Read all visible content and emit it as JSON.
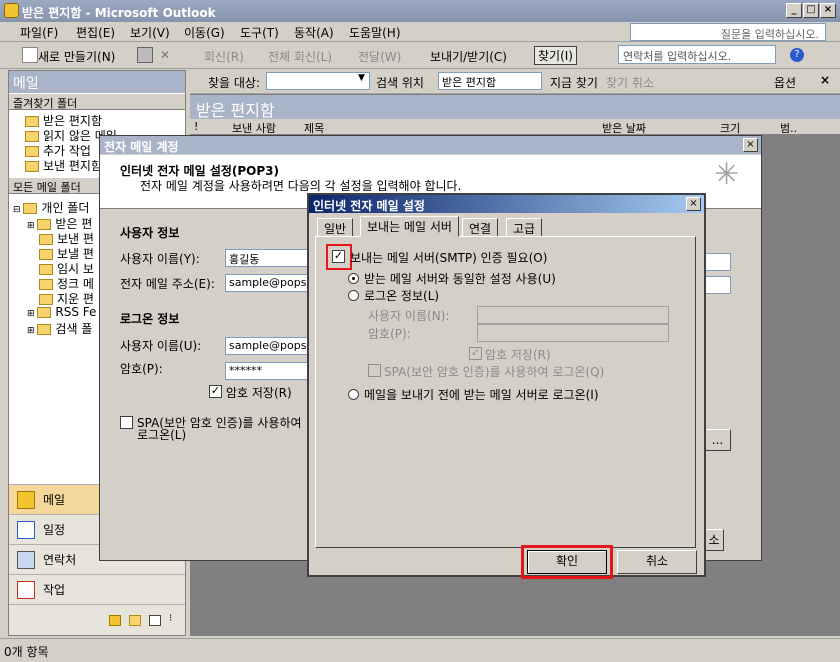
{
  "window": {
    "title": "받은 편지함 - Microsoft Outlook",
    "controls": [
      "_",
      "□",
      "×"
    ]
  },
  "menu": {
    "items": [
      "파일(F)",
      "편집(E)",
      "보기(V)",
      "이동(G)",
      "도구(T)",
      "동작(A)",
      "도움말(H)"
    ],
    "help_placeholder": "질문을 입력하십시오."
  },
  "toolbar": {
    "new": "새로 만들기(N)",
    "reply": "회신(R)",
    "reply_all": "전체 회신(L)",
    "forward": "전달(W)",
    "send_receive": "보내기/받기(C)",
    "find": "찾기(I)",
    "contacts_placeholder": "연락처를 입력하십시오."
  },
  "nav": {
    "header": "메일",
    "favorites_label": "즐겨찾기 폴더",
    "favorites": [
      "받은 편지함",
      "읽지 않은 메일",
      "추가 작업",
      "보낸 편지함"
    ],
    "all_label": "모든 메일 폴더",
    "personal": "개인 폴더",
    "tree": [
      "받은 편",
      "보낸 편",
      "보낼 편",
      "임시 보",
      "정크 메",
      "지운 편",
      "RSS Fe",
      "검색 폴"
    ],
    "buttons": [
      "메일",
      "일정",
      "연락처",
      "작업"
    ]
  },
  "search": {
    "find_target": "찾을 대상:",
    "search_location": "검색 위치",
    "location_value": "받은 편지함",
    "find_now": "지금 찾기",
    "clear": "찾기 취소",
    "options": "옵션"
  },
  "inbox": {
    "title": "받은 편지함",
    "columns": [
      "!",
      "보낸 사람",
      "제목",
      "받은 날짜",
      "크기",
      "범.."
    ]
  },
  "status": {
    "items": "0개 항목"
  },
  "account_dialog": {
    "title": "전자 메일 계정",
    "heading": "인터넷 전자 메일 설정(POP3)",
    "subheading": "전자 메일 계정을 사용하려면 다음의 각 설정을 입력해야 합니다.",
    "user_info": "사용자 정보",
    "user_name_label": "사용자 이름(Y):",
    "user_name": "홍길동",
    "email_label": "전자 메일 주소(E):",
    "email": "sample@pops",
    "logon_info": "로그온 정보",
    "logon_user_label": "사용자 이름(U):",
    "logon_user": "sample@pops",
    "password_label": "암호(P):",
    "password": "******",
    "save_password": "암호 저장(R)",
    "spa": "SPA(보안 암호 인증)를 사용하여",
    "spa2": "로그온(L)",
    "more_btn": "...",
    "next_btn": "소"
  },
  "settings_dialog": {
    "title": "인터넷 전자 메일 설정",
    "tabs": [
      "일반",
      "보내는 메일 서버",
      "연결",
      "고급"
    ],
    "smtp_auth": "보내는 메일 서버(SMTP) 인증 필요(O)",
    "same_settings": "받는 메일 서버와 동일한 설정 사용(U)",
    "logon_using": "로그온 정보(L)",
    "user_name_label": "사용자 이름(N):",
    "password_label": "암호(P):",
    "remember": "암호 저장(R)",
    "spa": "SPA(보안 암호 인증)를 사용하여 로그온(Q)",
    "logon_before": "메일을 보내기 전에 받는 메일 서버로 로그온(I)",
    "ok": "확인",
    "cancel": "취소"
  },
  "highlight_color": "#e8141c"
}
